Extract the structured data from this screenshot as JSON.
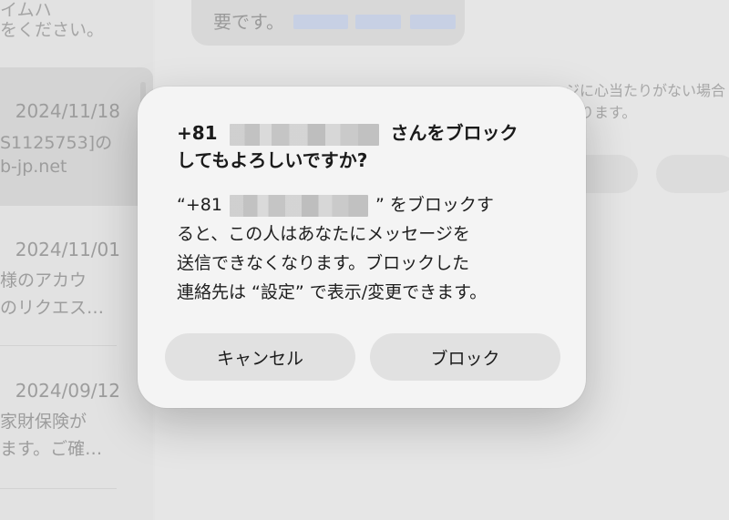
{
  "background": {
    "top_lines": [
      "イムハ",
      "をください。"
    ],
    "conversations": [
      {
        "date": "2024/11/18",
        "lines": [
          "S1125753]の",
          "b-jp.net"
        ],
        "selected": true
      },
      {
        "date": "2024/11/01",
        "lines": [
          "様のアカウ",
          "のリクエス…"
        ],
        "selected": false
      },
      {
        "date": "2024/09/12",
        "lines": [
          "家財保険が",
          "ます。ご確…"
        ],
        "selected": false
      }
    ],
    "chat": {
      "bubble_text": "要です。",
      "notice_text": "ジに心当たりがない場合\nあります。"
    }
  },
  "dialog": {
    "title_prefix": "+81",
    "title_suffix": "さんをブロック",
    "title_line2": "してもよろしいですか?",
    "message_prefix": "“+81",
    "message_suffix": "” をブロックす",
    "message_line2": "ると、この人はあなたにメッセージを",
    "message_line3": "送信できなくなります。ブロックした",
    "message_line4": "連絡先は “設定” で表示/変更できます。",
    "cancel_label": "キャンセル",
    "block_label": "ブロック"
  }
}
